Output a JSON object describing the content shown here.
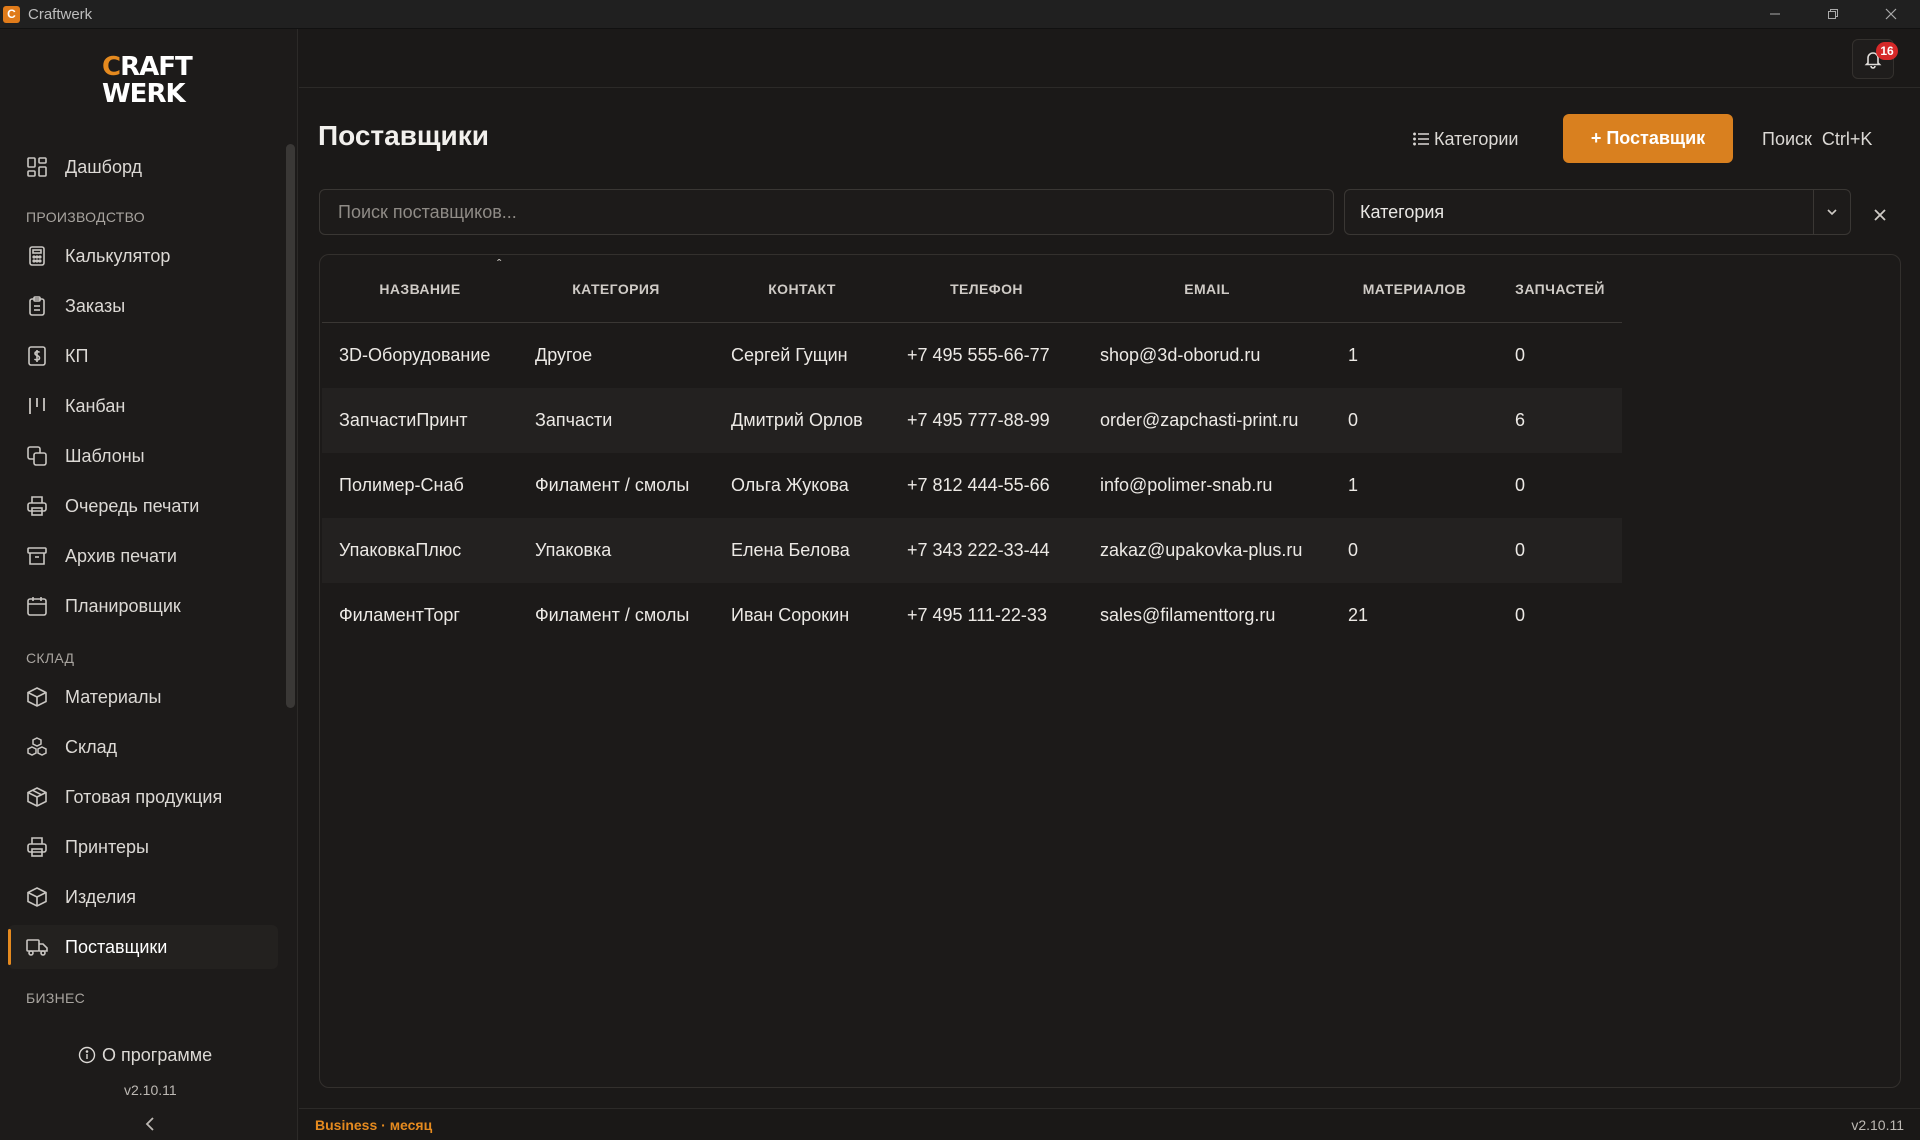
{
  "window": {
    "title": "Craftwerk"
  },
  "logo": {
    "line1_c": "C",
    "line1_rest": "RAFT",
    "line2": "WERK"
  },
  "sidebar": {
    "dashboard": "Дашборд",
    "sections": {
      "production": "ПРОИЗВОДСТВО",
      "warehouse": "СКЛАД",
      "business": "БИЗНЕС"
    },
    "production_items": [
      {
        "label": "Калькулятор",
        "icon": "calculator-icon"
      },
      {
        "label": "Заказы",
        "icon": "clipboard-icon"
      },
      {
        "label": "КП",
        "icon": "dollar-doc-icon"
      },
      {
        "label": "Канбан",
        "icon": "kanban-icon"
      },
      {
        "label": "Шаблоны",
        "icon": "copy-icon"
      },
      {
        "label": "Очередь печати",
        "icon": "printer-icon"
      },
      {
        "label": "Архив печати",
        "icon": "archive-icon"
      },
      {
        "label": "Планировщик",
        "icon": "calendar-icon"
      }
    ],
    "warehouse_items": [
      {
        "label": "Материалы",
        "icon": "box-icon"
      },
      {
        "label": "Склад",
        "icon": "boxes-icon"
      },
      {
        "label": "Готовая продукция",
        "icon": "package-icon"
      },
      {
        "label": "Принтеры",
        "icon": "printer-icon"
      },
      {
        "label": "Изделия",
        "icon": "cube-icon"
      },
      {
        "label": "Поставщики",
        "icon": "truck-icon"
      }
    ],
    "about": "О программе",
    "version": "v2.10.11"
  },
  "topbar": {
    "notifications_count": "16"
  },
  "header": {
    "title": "Поставщики",
    "categories_btn": "Категории",
    "add_btn": "+ Поставщик",
    "search_label": "Поиск",
    "search_shortcut": "Ctrl+K"
  },
  "filters": {
    "search_placeholder": "Поиск поставщиков...",
    "search_value": "",
    "category_value": "Категория"
  },
  "table": {
    "columns": [
      "НАЗВАНИЕ",
      "КАТЕГОРИЯ",
      "КОНТАКТ",
      "ТЕЛЕФОН",
      "EMAIL",
      "МАТЕРИАЛОВ",
      "ЗАПЧАСТЕЙ"
    ],
    "rows": [
      [
        "3D-Оборудование",
        "Другое",
        "Сергей Гущин",
        "+7 495 555-66-77",
        "shop@3d-oborud.ru",
        "1",
        "0"
      ],
      [
        "ЗапчастиПринт",
        "Запчасти",
        "Дмитрий Орлов",
        "+7 495 777-88-99",
        "order@zapchasti-print.ru",
        "0",
        "6"
      ],
      [
        "Полимер-Снаб",
        "Филамент / смолы",
        "Ольга Жукова",
        "+7 812 444-55-66",
        "info@polimer-snab.ru",
        "1",
        "0"
      ],
      [
        "УпаковкаПлюс",
        "Упаковка",
        "Елена Белова",
        "+7 343 222-33-44",
        "zakaz@upakovka-plus.ru",
        "0",
        "0"
      ],
      [
        "ФиламентТорг",
        "Филамент / смолы",
        "Иван Сорокин",
        "+7 495 111-22-33",
        "sales@filamenttorg.ru",
        "21",
        "0"
      ]
    ]
  },
  "statusbar": {
    "plan": "Business · месяц",
    "version": "v2.10.11"
  },
  "colors": {
    "accent": "#d9801f",
    "badge": "#d62828",
    "background": "#1b1918"
  }
}
